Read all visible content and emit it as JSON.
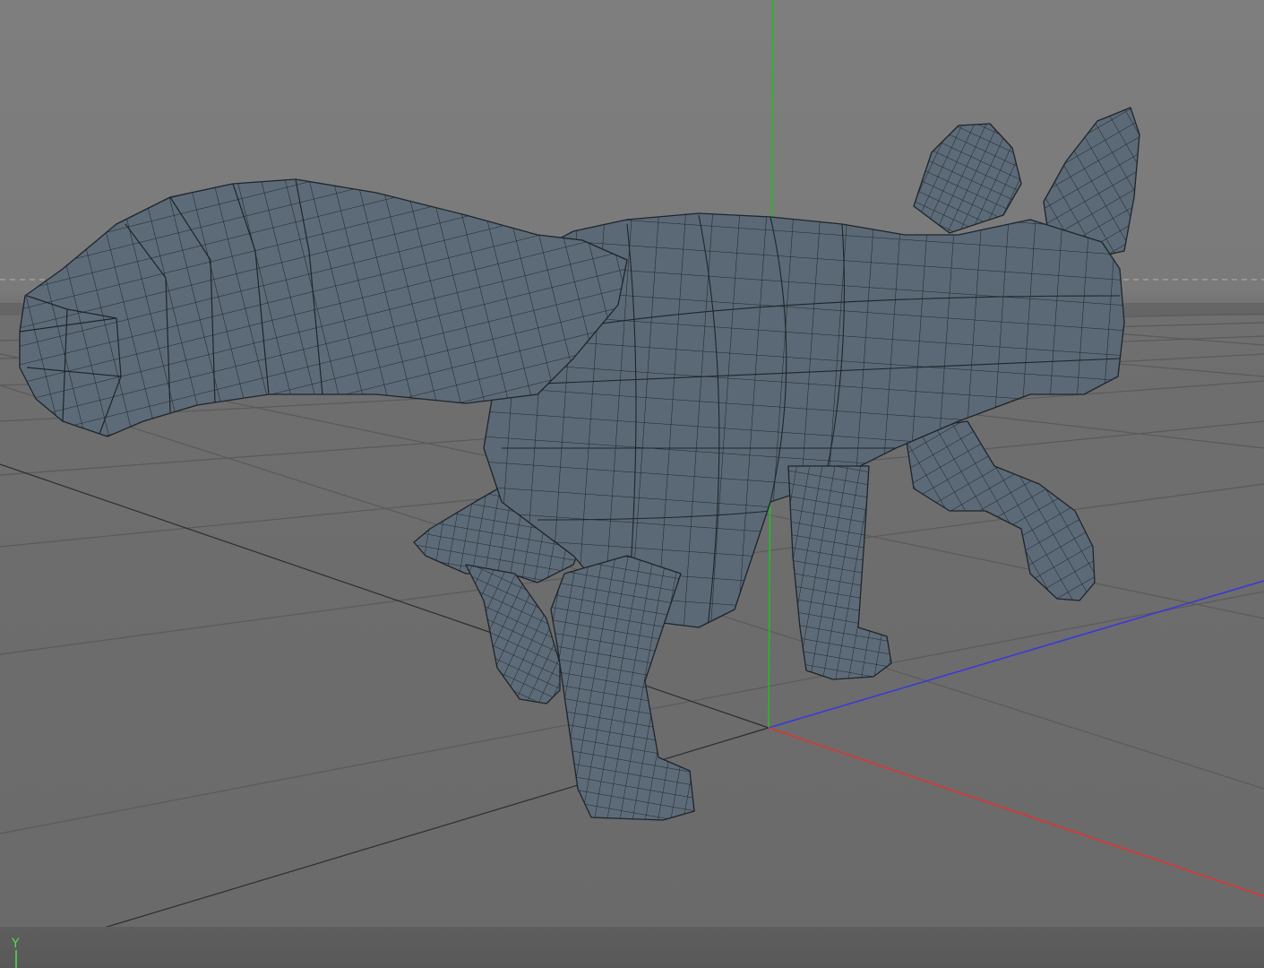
{
  "viewport": {
    "background_top": "#7d7d7d",
    "background_mid": "#7a7a7a",
    "floor": "#6b6b6b",
    "grid_color": "#5a5a5a",
    "horizon_line": "#4d4d4d",
    "mesh_fill": "#5d6b78",
    "mesh_wire": "#1e252b",
    "axis_x_color": "#e03333",
    "axis_y_color": "#22bb22",
    "axis_z_color": "#3a3ad8"
  },
  "gizmo": {
    "label": "Y",
    "icon": "axis-gizmo-icon"
  }
}
